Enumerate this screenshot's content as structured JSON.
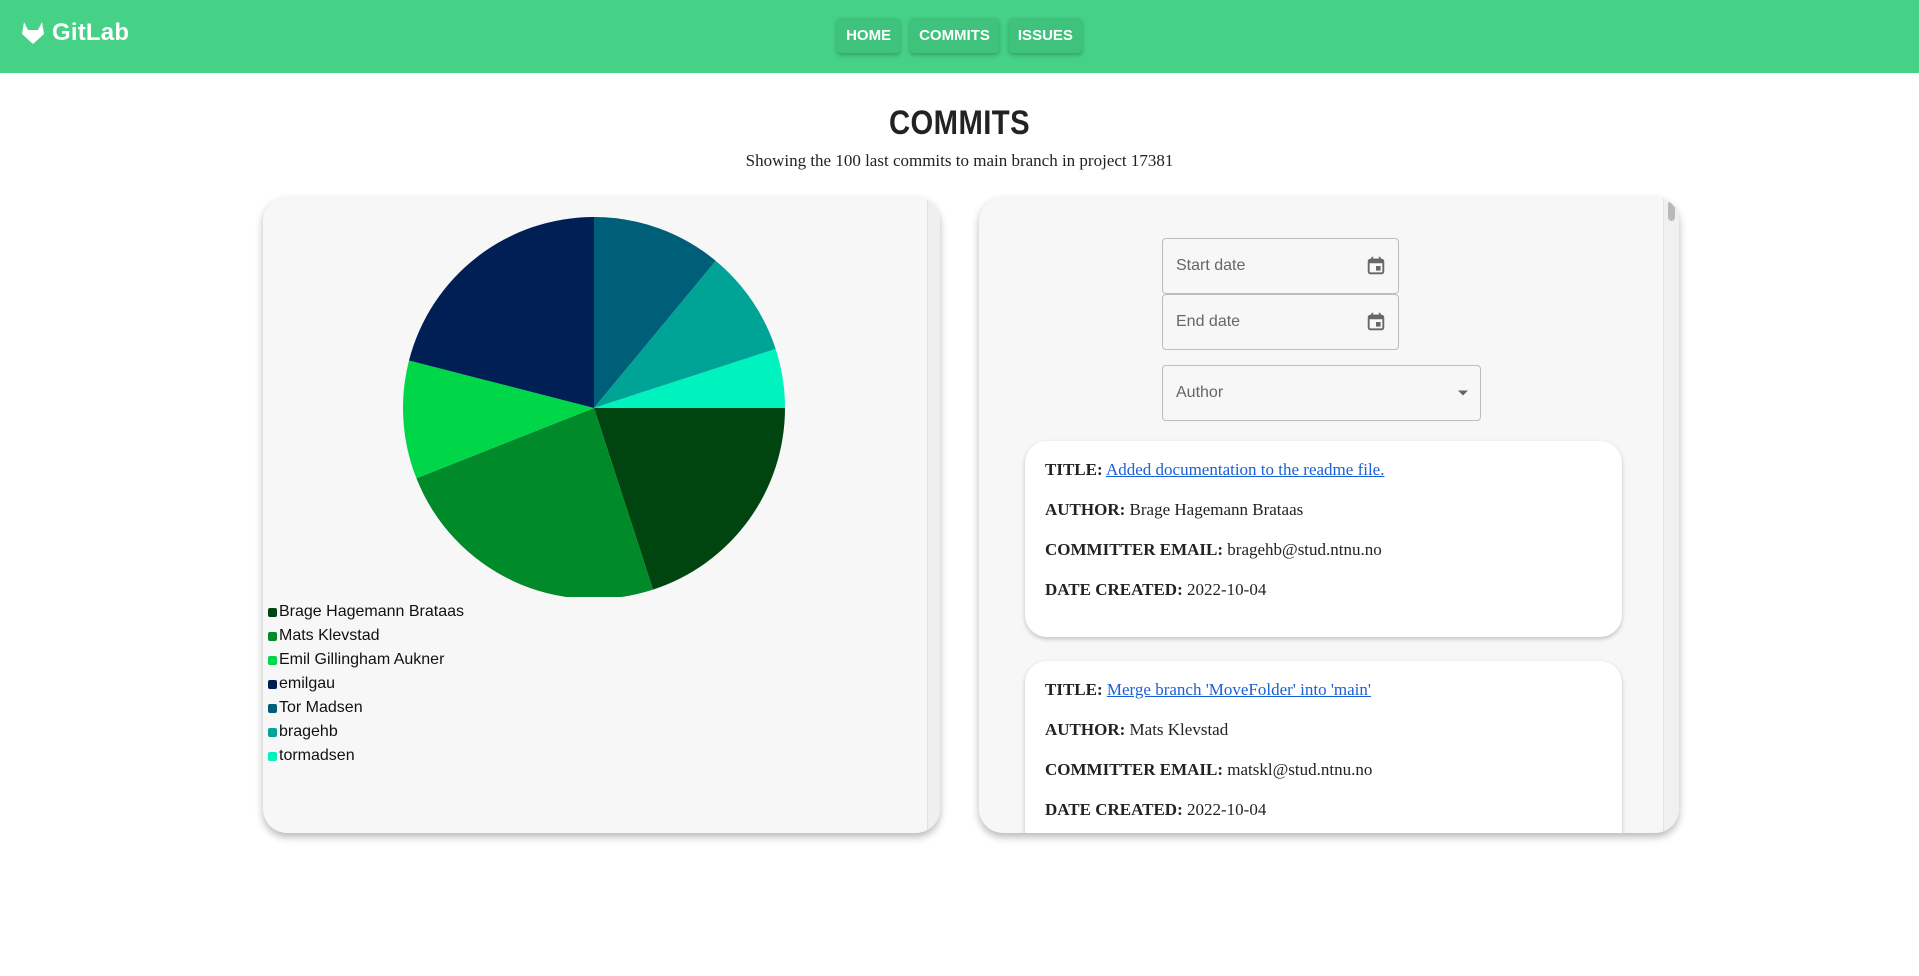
{
  "brand": {
    "name": "GitLab",
    "logo_icon": "gitlab-fox-icon"
  },
  "nav": [
    {
      "label": "HOME"
    },
    {
      "label": "COMMITS"
    },
    {
      "label": "ISSUES"
    }
  ],
  "page": {
    "title": "COMMITS",
    "subtitle": "Showing the 100 last commits to main branch in project 17381"
  },
  "chart_data": {
    "type": "pie",
    "title": "",
    "legend_position": "bottom-left",
    "slices": [
      {
        "label": "Brage Hagemann Brataas",
        "value": 20,
        "color": "#00450f"
      },
      {
        "label": "Mats Klevstad",
        "value": 24,
        "color": "#008a2a"
      },
      {
        "label": "Emil Gillingham Aukner",
        "value": 10,
        "color": "#00d748"
      },
      {
        "label": "emilgau",
        "value": 21,
        "color": "#001f55"
      },
      {
        "label": "Tor Madsen",
        "value": 11,
        "color": "#005f78"
      },
      {
        "label": "bragehb",
        "value": 9,
        "color": "#00a496"
      },
      {
        "label": "tormadsen",
        "value": 5,
        "color": "#00f2bf"
      }
    ]
  },
  "filters": {
    "start_date_label": "Start date",
    "end_date_label": "End date",
    "author_label": "Author",
    "calendar_icon": "calendar-icon",
    "dropdown_icon": "caret-down-icon"
  },
  "commit_labels": {
    "title": "TITLE:",
    "author": "AUTHOR:",
    "email": "COMMITTER EMAIL:",
    "date": "DATE CREATED:"
  },
  "commits": [
    {
      "title": "Added documentation to the readme file.",
      "author": "Brage Hagemann Brataas",
      "email": "bragehb@stud.ntnu.no",
      "date": "2022-10-04"
    },
    {
      "title": "Merge branch 'MoveFolder' into 'main'",
      "author": "Mats Klevstad",
      "email": "matskl@stud.ntnu.no",
      "date": "2022-10-04"
    }
  ]
}
